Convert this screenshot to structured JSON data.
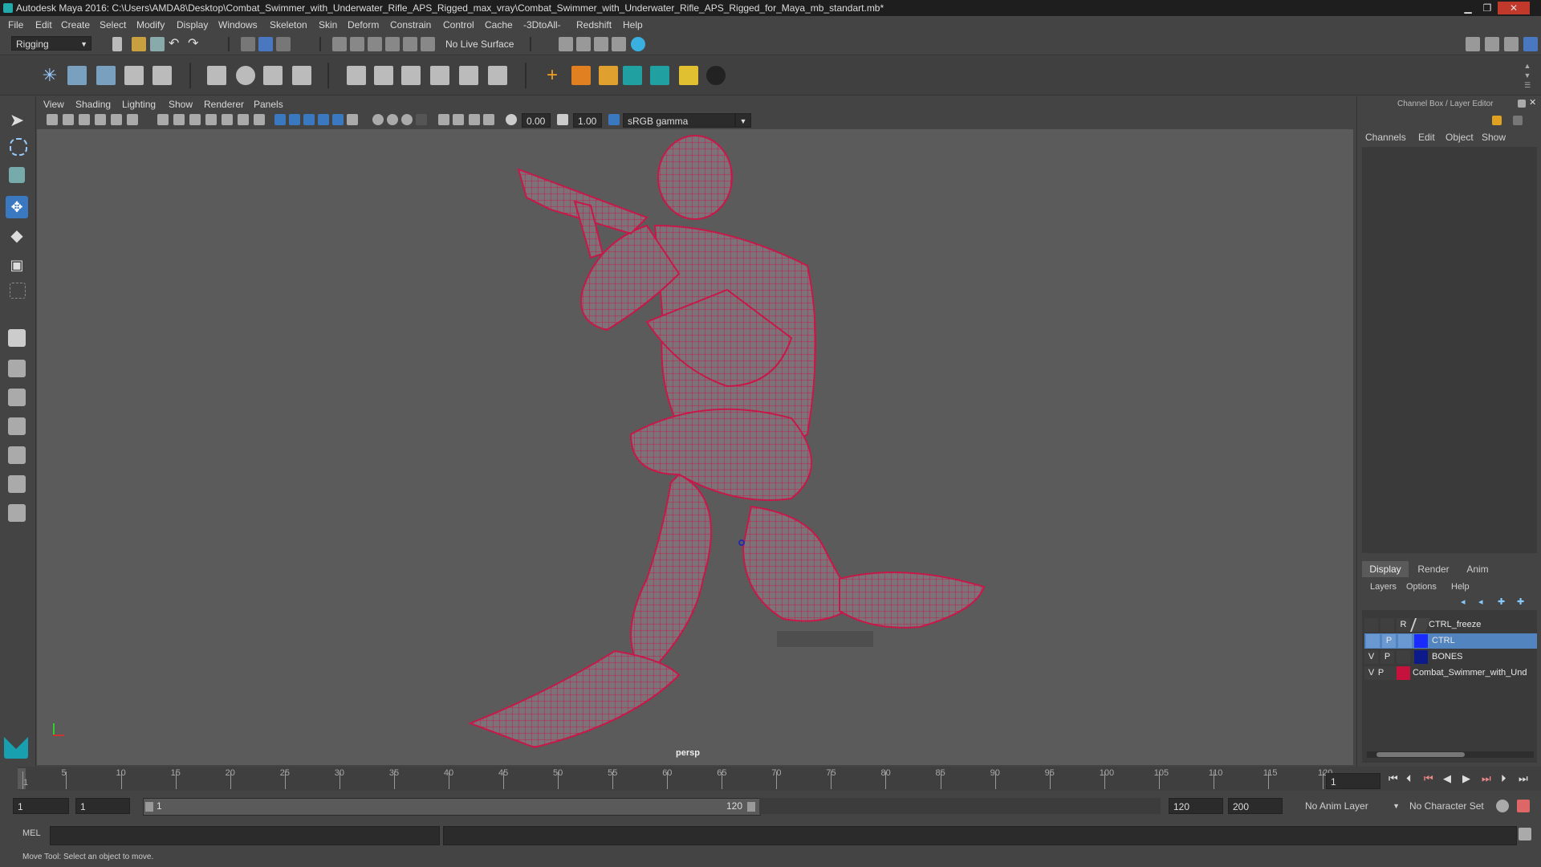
{
  "window": {
    "title": "Autodesk Maya 2016: C:\\Users\\AMDA8\\Desktop\\Combat_Swimmer_with_Underwater_Rifle_APS_Rigged_max_vray\\Combat_Swimmer_with_Underwater_Rifle_APS_Rigged_for_Maya_mb_standart.mb*",
    "minimize": "▁",
    "maximize": "❐",
    "close": "✕"
  },
  "menubar": [
    "File",
    "Edit",
    "Create",
    "Select",
    "Modify",
    "Display",
    "Windows",
    "Skeleton",
    "Skin",
    "Deform",
    "Constrain",
    "Control",
    "Cache",
    "-3DtoAll-",
    "Redshift",
    "Help"
  ],
  "status_line": {
    "menu_set": "Rigging",
    "live_surface": "No Live Surface"
  },
  "viewport": {
    "menu": [
      "View",
      "Shading",
      "Lighting",
      "Show",
      "Renderer",
      "Panels"
    ],
    "exposure": "0.00",
    "gamma": "1.00",
    "color_space": "sRGB gamma",
    "camera_label": "persp"
  },
  "channel_box": {
    "title": "Channel Box / Layer Editor",
    "menu": [
      "Channels",
      "Edit",
      "Object",
      "Show"
    ]
  },
  "layer_editor": {
    "tabs": [
      "Display",
      "Render",
      "Anim"
    ],
    "active_tab": "Display",
    "menu": [
      "Layers",
      "Options",
      "Help"
    ],
    "layers": [
      {
        "v": "",
        "p": "",
        "r": "R",
        "color": "#444444",
        "name": "CTRL_freeze",
        "selected": false
      },
      {
        "v": "",
        "p": "P",
        "r": "",
        "color": "#1a2bff",
        "name": "CTRL",
        "selected": true
      },
      {
        "v": "V",
        "p": "P",
        "r": "",
        "color": "#0c1a8a",
        "name": "BONES",
        "selected": false
      },
      {
        "v": "V",
        "p": "P",
        "r": "",
        "color": "#c4123c",
        "name": "Combat_Swimmer_with_Und",
        "selected": false
      }
    ]
  },
  "timeline": {
    "ticks": [
      "1",
      "5",
      "10",
      "15",
      "20",
      "25",
      "30",
      "35",
      "40",
      "45",
      "50",
      "55",
      "60",
      "65",
      "70",
      "75",
      "80",
      "85",
      "90",
      "95",
      "100",
      "105",
      "110",
      "115",
      "120"
    ],
    "current_frame": "1"
  },
  "range": {
    "start": "1",
    "playback_start": "1",
    "slider_start": "1",
    "slider_end": "120",
    "playback_end": "120",
    "end": "200",
    "anim_layer": "No Anim Layer",
    "character_set": "No Character Set"
  },
  "command": {
    "language": "MEL"
  },
  "help_line": "Move Tool: Select an object to move.",
  "colors": {
    "wireframe": "#c8184a",
    "bones": "#2a2aaa",
    "background": "#5b5b5b"
  }
}
